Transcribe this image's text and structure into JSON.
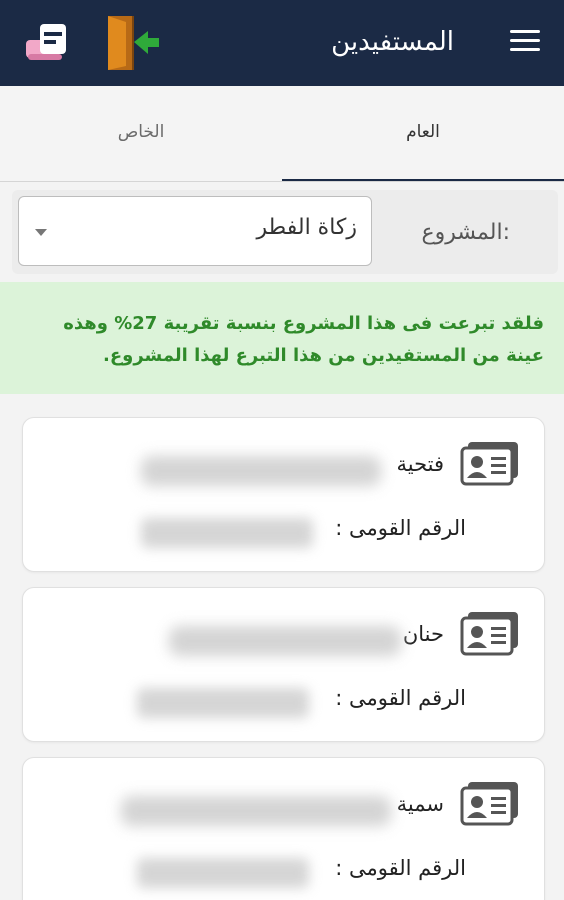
{
  "header": {
    "title": "المستفيدين",
    "menu_icon": "hamburger-menu-icon",
    "logout_icon": "door-exit-icon",
    "logo_icon": "app-logo",
    "background": "#1b2a45"
  },
  "tabs": [
    {
      "label": "العام",
      "active": true
    },
    {
      "label": "الخاص",
      "active": false
    }
  ],
  "project": {
    "label": "المشروع:",
    "selected": "زكاة الفطر"
  },
  "notice": {
    "text": "فلقد تبرعت فى هذا المشروع بنسبة تقريبة 27% وهذه عينة من المستفيدين من هذا التبرع لهذا المشروع.",
    "color": "#2f8a2a",
    "background": "#dcf3d9"
  },
  "beneficiaries": [
    {
      "name": "فتحية",
      "id_label": "الرقم القومى :"
    },
    {
      "name": "حنان",
      "id_label": "الرقم القومى :"
    },
    {
      "name": "سمية",
      "id_label": "الرقم القومى :"
    }
  ]
}
